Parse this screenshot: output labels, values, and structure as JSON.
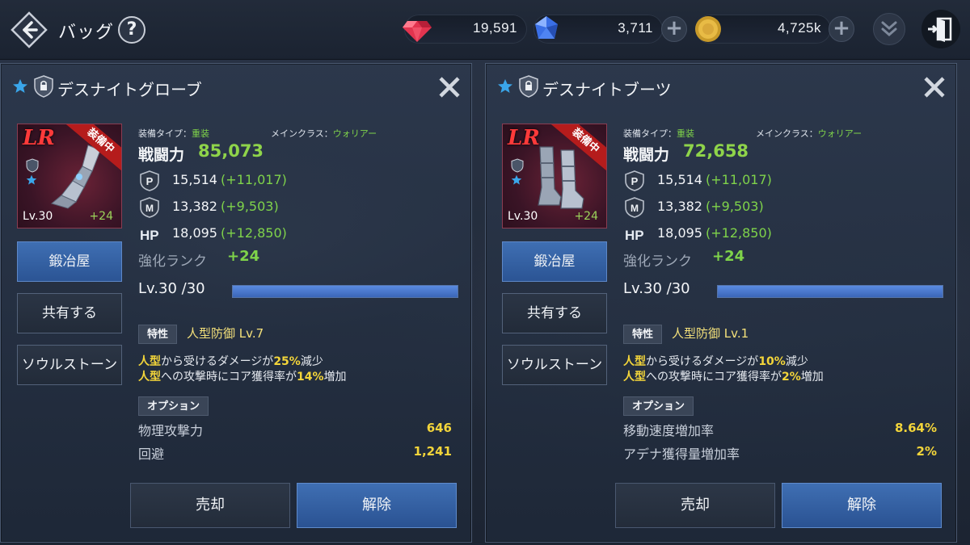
{
  "header": {
    "title": "バッグ",
    "help_label": "?",
    "currencies": [
      {
        "icon": "red-gem-icon",
        "amount": "19,591"
      },
      {
        "icon": "blue-gem-icon",
        "amount": "3,711"
      },
      {
        "icon": "gold-coin-icon",
        "amount": "4,725k"
      }
    ]
  },
  "panels": [
    {
      "title": "デスナイトグローブ",
      "card": {
        "rarity": "LR",
        "badge": "装備中",
        "level": "Lv.30",
        "plus": "+24"
      },
      "buttons": {
        "smith": "鍛冶屋",
        "share": "共有する",
        "soulstone": "ソウルストーン"
      },
      "meta": {
        "equip_type_label": "装備タイプ：",
        "equip_type": "重装",
        "main_class_label": "メインクラス：",
        "main_class": "ウォリアー"
      },
      "power_label": "戦闘力",
      "power": "85,073",
      "stats": [
        {
          "icon": "P",
          "value": "15,514",
          "bonus": "(+11,017)"
        },
        {
          "icon": "M",
          "value": "13,382",
          "bonus": "(+9,503)"
        },
        {
          "icon": "HP",
          "value": "18,095",
          "bonus": "(+12,850)"
        }
      ],
      "rank_label": "強化ランク",
      "rank": "+24",
      "level_text": "Lv.30 /30",
      "level_progress": 1.0,
      "trait_tag": "特性",
      "trait_name": "人型防御 Lv.7",
      "trait_desc1": {
        "hl1": "人型",
        "t1": "から受けるダメージが",
        "hl2": "25%",
        "t2": "減少"
      },
      "trait_desc2": {
        "hl1": "人型",
        "t1": "への攻撃時にコア獲得率が",
        "hl2": "14%",
        "t2": "増加"
      },
      "option_tag": "オプション",
      "options": [
        {
          "label": "物理攻撃力",
          "value": "646"
        },
        {
          "label": "回避",
          "value": "1,241"
        }
      ],
      "sell": "売却",
      "unequip": "解除"
    },
    {
      "title": "デスナイトブーツ",
      "card": {
        "rarity": "LR",
        "badge": "装備中",
        "level": "Lv.30",
        "plus": "+24"
      },
      "buttons": {
        "smith": "鍛冶屋",
        "share": "共有する",
        "soulstone": "ソウルストーン"
      },
      "meta": {
        "equip_type_label": "装備タイプ：",
        "equip_type": "重装",
        "main_class_label": "メインクラス：",
        "main_class": "ウォリアー"
      },
      "power_label": "戦闘力",
      "power": "72,658",
      "stats": [
        {
          "icon": "P",
          "value": "15,514",
          "bonus": "(+11,017)"
        },
        {
          "icon": "M",
          "value": "13,382",
          "bonus": "(+9,503)"
        },
        {
          "icon": "HP",
          "value": "18,095",
          "bonus": "(+12,850)"
        }
      ],
      "rank_label": "強化ランク",
      "rank": "+24",
      "level_text": "Lv.30 /30",
      "level_progress": 1.0,
      "trait_tag": "特性",
      "trait_name": "人型防御 Lv.1",
      "trait_desc1": {
        "hl1": "人型",
        "t1": "から受けるダメージが",
        "hl2": "10%",
        "t2": "減少"
      },
      "trait_desc2": {
        "hl1": "人型",
        "t1": "への攻撃時にコア獲得率が",
        "hl2": "2%",
        "t2": "増加"
      },
      "option_tag": "オプション",
      "options": [
        {
          "label": "移動速度増加率",
          "value": "8.64%"
        },
        {
          "label": "アデナ獲得量増加率",
          "value": "2%"
        }
      ],
      "sell": "売却",
      "unequip": "解除"
    }
  ]
}
